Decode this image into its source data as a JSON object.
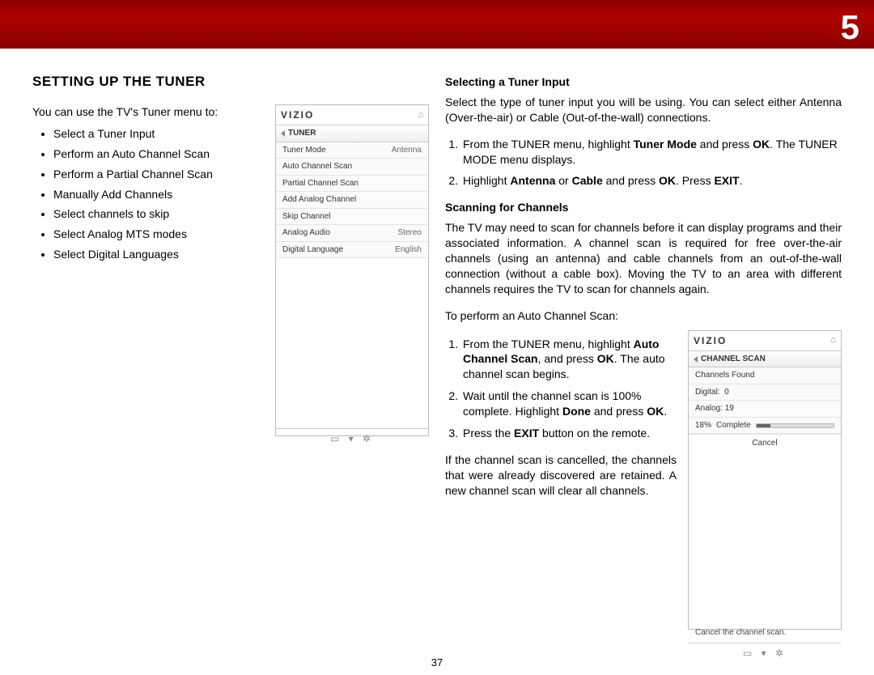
{
  "header": {
    "chapter_number": "5"
  },
  "left": {
    "title": "SETTING UP THE TUNER",
    "intro": "You can use the TV's Tuner menu to:",
    "bullets": [
      "Select a Tuner Input",
      "Perform an Auto Channel Scan",
      "Perform a Partial Channel Scan",
      "Manually Add Channels",
      "Select channels to skip",
      "Select Analog MTS modes",
      "Select Digital Languages"
    ]
  },
  "osd_tuner": {
    "brand": "VIZIO",
    "home_glyph": "⌂",
    "title": "TUNER",
    "rows": [
      {
        "label": "Tuner Mode",
        "value": "Antenna"
      },
      {
        "label": "Auto Channel Scan",
        "value": ""
      },
      {
        "label": "Partial Channel Scan",
        "value": ""
      },
      {
        "label": "Add Analog Channel",
        "value": ""
      },
      {
        "label": "Skip Channel",
        "value": ""
      },
      {
        "label": "Analog Audio",
        "value": "Stereo"
      },
      {
        "label": "Digital Language",
        "value": "English"
      }
    ],
    "foot_glyphs": "▭ ▾ ✲"
  },
  "right": {
    "sec1_head": "Selecting a Tuner Input",
    "sec1_para": "Select the type of tuner input you will be using. You can select either Antenna (Over-the-air) or Cable (Out-of-the-wall) connections.",
    "sec1_steps": [
      {
        "pre": "From the TUNER menu, highlight ",
        "b1": "Tuner Mode",
        "mid": " and press ",
        "b2": "OK",
        "post": ". The TUNER MODE menu displays."
      },
      {
        "pre": "Highlight ",
        "b1": "Antenna",
        "mid": " or ",
        "b2": "Cable",
        "mid2": " and press ",
        "b3": "OK",
        "mid3": ". Press ",
        "b4": "EXIT",
        "post": "."
      }
    ],
    "sec2_head": "Scanning for Channels",
    "sec2_para": "The TV may need to scan for channels before it can display programs and their associated information. A channel scan is required for free over-the-air channels (using an antenna) and cable channels from an out-of-the-wall connection (without a cable box). Moving the TV to an area with different channels requires the TV to scan for channels again.",
    "sec2_lead": "To perform an Auto Channel Scan:",
    "sec2_steps": [
      {
        "pre": "From the TUNER menu, highlight ",
        "b1": "Auto Channel Scan",
        "mid": ", and press ",
        "b2": "OK",
        "post": ". The auto channel scan begins."
      },
      {
        "pre": "Wait until the channel scan is 100% complete. Highlight ",
        "b1": "Done",
        "mid": " and press ",
        "b2": "OK",
        "post": "."
      },
      {
        "pre": "Press the ",
        "b1": "EXIT",
        "post": " button on the remote."
      }
    ],
    "sec2_tail": "If the channel scan is cancelled, the channels that were already discovered are retained. A new channel scan will clear all channels."
  },
  "osd_scan": {
    "brand": "VIZIO",
    "home_glyph": "⌂",
    "title": "CHANNEL SCAN",
    "found_label": "Channels Found",
    "digital_label": "Digital:",
    "digital_value": "0",
    "analog_label": "Analog:",
    "analog_value": "19",
    "pct_label": "18%",
    "pct_value": 18,
    "complete_label": "Complete",
    "cancel_label": "Cancel",
    "hint": "Cancel the channel scan.",
    "foot_glyphs": "▭ ▾ ✲"
  },
  "page_number": "37"
}
